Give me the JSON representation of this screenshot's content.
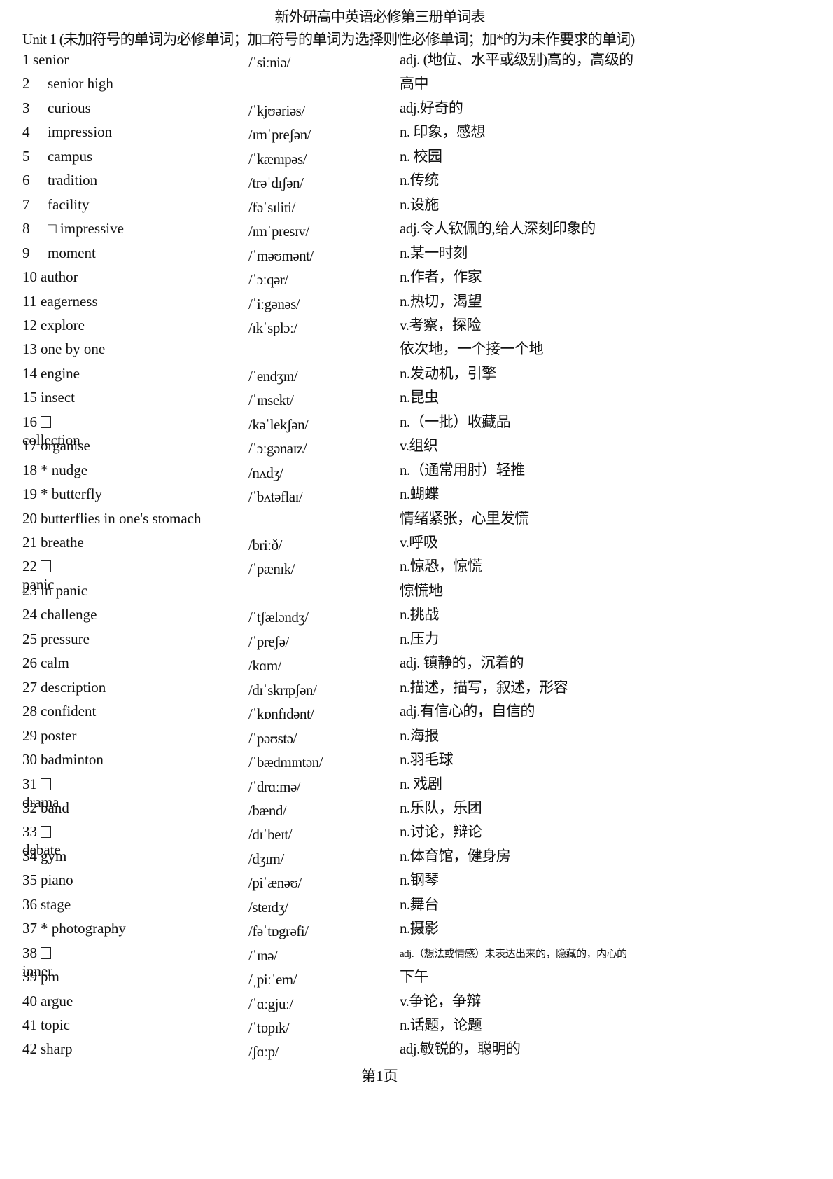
{
  "title": "新外研高中英语必修第三册单词表",
  "subtitle": "Unit 1 (未加符号的单词为必修单词；加□符号的单词为选择则性必修单词；加*的为未作要求的单词)",
  "footer": "第1页",
  "entries": [
    {
      "num": "1",
      "word": "senior",
      "phonetic": "/ˈsiːniə/",
      "meaning": "adj. (地位、水平或级别)高的，高级的"
    },
    {
      "num": "2",
      "word": "senior high",
      "phonetic": "",
      "meaning": "高中"
    },
    {
      "num": "3",
      "word": "curious",
      "phonetic": "/ˈkjʊəriəs/",
      "meaning": "adj.好奇的"
    },
    {
      "num": "4",
      "word": "impression",
      "phonetic": "/ɪmˈpreʃən/",
      "meaning": "n. 印象，感想"
    },
    {
      "num": "5",
      "word": "campus",
      "phonetic": "/ˈkæmpəs/",
      "meaning": "n. 校园"
    },
    {
      "num": "6",
      "word": "tradition",
      "phonetic": "/trəˈdɪʃən/",
      "meaning": "n.传统"
    },
    {
      "num": "7",
      "word": "facility",
      "phonetic": "/fəˈsɪliti/",
      "meaning": "n.设施"
    },
    {
      "num": "8",
      "word": "□ impressive",
      "phonetic": "/ɪmˈpresɪv/",
      "meaning": "adj.令人钦佩的,给人深刻印象的"
    },
    {
      "num": "9",
      "word": "moment",
      "phonetic": "/ˈməʊmənt/",
      "meaning": "n.某一时刻"
    },
    {
      "num": "10",
      "word": "author",
      "phonetic": "/ˈɔːqər/",
      "meaning": "n.作者，作家"
    },
    {
      "num": "11",
      "word": "eagerness",
      "phonetic": "/ˈiːgənəs/",
      "meaning": "n.热切，渴望"
    },
    {
      "num": "12",
      "word": "explore",
      "phonetic": "/ɪkˈsplɔː/",
      "meaning": "v.考察，探险"
    },
    {
      "num": "13",
      "word": "one by one",
      "phonetic": "",
      "meaning": "依次地，一个接一个地"
    },
    {
      "num": "14",
      "word": "engine",
      "phonetic": "/ˈendʒɪn/",
      "meaning": "n.发动机，引擎"
    },
    {
      "num": "15",
      "word": "insect",
      "phonetic": "/ˈɪnsekt/",
      "meaning": "n.昆虫"
    },
    {
      "num": "16",
      "boxed": true,
      "word": "collection",
      "phonetic": "/kəˈlekʃən/",
      "meaning": "n.（一批）收藏品"
    },
    {
      "num": "17",
      "word": "organise",
      "phonetic": "/ˈɔːgənaɪz/",
      "meaning": "v.组织"
    },
    {
      "num": "18",
      "word": "* nudge",
      "phonetic": "/nʌdʒ/",
      "meaning": "n.（通常用肘）轻推"
    },
    {
      "num": "19",
      "word": "* butterfly",
      "phonetic": "/ˈbʌtəflaɪ/",
      "meaning": "n.蝴蝶"
    },
    {
      "num": "20",
      "word": "butterflies in one's stomach",
      "phonetic": "",
      "meaning": "情绪紧张，心里发慌"
    },
    {
      "num": "21",
      "word": "breathe",
      "phonetic": "/briːð/",
      "meaning": "v.呼吸"
    },
    {
      "num": "22",
      "boxed": true,
      "word": "panic",
      "phonetic": "/ˈpænɪk/",
      "meaning": "n.惊恐，惊慌"
    },
    {
      "num": "23",
      "word": "in panic",
      "phonetic": "",
      "meaning": "惊慌地"
    },
    {
      "num": "24",
      "word": "challenge",
      "phonetic": "/ˈtʃæləndʒ/",
      "meaning": "n.挑战"
    },
    {
      "num": "25",
      "word": "pressure",
      "phonetic": "/ˈpreʃə/",
      "meaning": "n.压力"
    },
    {
      "num": "26",
      "word": "calm",
      "phonetic": "/kɑm/",
      "meaning": "adj. 镇静的，沉着的"
    },
    {
      "num": "27",
      "word": "description",
      "phonetic": "/dɪˈskrɪpʃən/",
      "meaning": "n.描述，描写，叙述，形容"
    },
    {
      "num": "28",
      "word": "confident",
      "phonetic": "/ˈkɒnfɪdənt/",
      "meaning": "adj.有信心的，自信的"
    },
    {
      "num": "29",
      "word": "poster",
      "phonetic": "/ˈpəʊstə/",
      "meaning": "n.海报"
    },
    {
      "num": "30",
      "word": "badminton",
      "phonetic": "/ˈbædmɪntən/",
      "meaning": "n.羽毛球"
    },
    {
      "num": "31",
      "boxed": true,
      "word": "drama",
      "phonetic": "/ˈdrɑːmə/",
      "meaning": "n. 戏剧"
    },
    {
      "num": "32",
      "word": "band",
      "phonetic": "/bænd/",
      "meaning": "n.乐队，乐团"
    },
    {
      "num": "33",
      "boxed": true,
      "word": "debate",
      "phonetic": "/dɪˈbeɪt/",
      "meaning": "n.讨论，辩论"
    },
    {
      "num": "34",
      "word": "gym",
      "phonetic": "/dʒɪm/",
      "meaning": "n.体育馆，健身房"
    },
    {
      "num": "35",
      "word": "piano",
      "phonetic": "/piˈænəʊ/",
      "meaning": "n.钢琴"
    },
    {
      "num": "36",
      "word": "stage",
      "phonetic": "/steɪdʒ/",
      "meaning": "n.舞台"
    },
    {
      "num": "37",
      "word": "* photography",
      "phonetic": "/fəˈtɒgrəfi/",
      "meaning": "n.摄影"
    },
    {
      "num": "38",
      "boxed": true,
      "word": "inner",
      "phonetic": "/ˈɪnə/",
      "meaning": "adj.（想法或情感）未表达出来的，隐藏的，内心的",
      "small": true
    },
    {
      "num": "39",
      "word": "pm",
      "phonetic": "/ˌpiːˈem/",
      "meaning": "下午"
    },
    {
      "num": "40",
      "word": "argue",
      "phonetic": "/ˈɑːgjuː/",
      "meaning": "v.争论，争辩"
    },
    {
      "num": "41",
      "word": "topic",
      "phonetic": "/ˈtɒpɪk/",
      "meaning": "n.话题，论题"
    },
    {
      "num": "42",
      "word": "sharp",
      "phonetic": "/ʃɑːp/",
      "meaning": "adj.敏锐的，聪明的"
    }
  ]
}
